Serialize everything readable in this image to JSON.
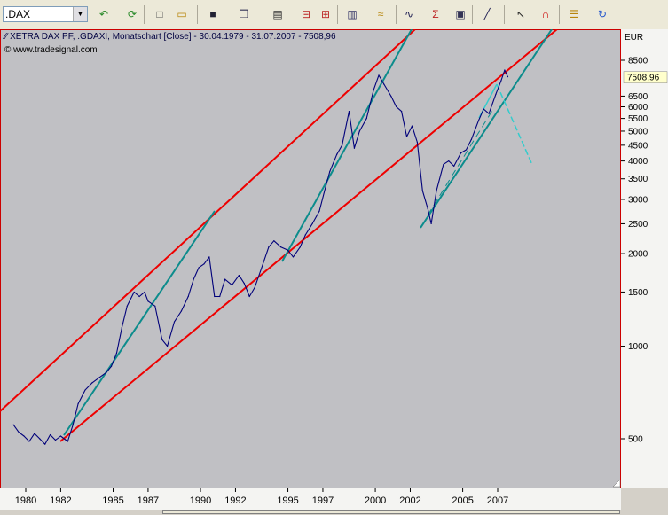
{
  "toolbar": {
    "symbol": ".DAX",
    "buttons": [
      {
        "name": "undo-arrow-icon",
        "glyph": "↶",
        "color": "#2a8a2a"
      },
      {
        "name": "refresh-icon",
        "glyph": "⟳",
        "color": "#2a8a2a"
      },
      {
        "name": "new-document-icon",
        "glyph": "□",
        "color": "#555"
      },
      {
        "name": "open-folder-icon",
        "glyph": "▭",
        "color": "#b8860b"
      },
      {
        "name": "save-disk-icon",
        "glyph": "■",
        "color": "#223"
      },
      {
        "name": "copy-icon",
        "glyph": "❐",
        "color": "#335"
      },
      {
        "name": "print-icon",
        "glyph": "▤",
        "color": "#333"
      },
      {
        "name": "chart-window-icon",
        "glyph": "⊟",
        "color": "#b22"
      },
      {
        "name": "chart-window-2-icon",
        "glyph": "⊞",
        "color": "#b22"
      },
      {
        "name": "layout-icon",
        "glyph": "▥",
        "color": "#336"
      },
      {
        "name": "indicator-icon",
        "glyph": "≈",
        "color": "#b8860b"
      },
      {
        "name": "studies-icon",
        "glyph": "∿",
        "color": "#225"
      },
      {
        "name": "sigma-icon",
        "glyph": "Σ",
        "color": "#b22"
      },
      {
        "name": "properties-icon",
        "glyph": "▣",
        "color": "#335"
      },
      {
        "name": "draw-line-icon",
        "glyph": "╱",
        "color": "#225"
      },
      {
        "name": "cursor-icon",
        "glyph": "↖",
        "color": "#222"
      },
      {
        "name": "magnet-icon",
        "glyph": "∩",
        "color": "#c00"
      },
      {
        "name": "settings-icon",
        "glyph": "☰",
        "color": "#b8860b"
      },
      {
        "name": "rotate-icon",
        "glyph": "↻",
        "color": "#2255cc"
      }
    ]
  },
  "chart_title": "XETRA DAX PF, .GDAXI, Monatschart [Close] - 30.04.1979 - 31.07.2007 - 7508,96",
  "copyright": "© www.tradesignal.com",
  "colors": {
    "plot_bg": "#c0c0c4",
    "price_line": "#00007a",
    "channel": "#ee0000",
    "trend": "#0c8c8c",
    "projection": "#33cccc",
    "last_label_bg": "#ffffcc"
  },
  "chart_data": {
    "type": "line",
    "title": "XETRA DAX PF, .GDAXI, Monatschart [Close] - 30.04.1979 - 31.07.2007 - 7508,96",
    "scale": "log",
    "y_unit": "EUR",
    "last_value_label": "7508,96",
    "y_ticks": [
      {
        "value": 500,
        "label": "500"
      },
      {
        "value": 1000,
        "label": "1000"
      },
      {
        "value": 1500,
        "label": "1500"
      },
      {
        "value": 2000,
        "label": "2000"
      },
      {
        "value": 2500,
        "label": "2500"
      },
      {
        "value": 3000,
        "label": "3000"
      },
      {
        "value": 3500,
        "label": "3500"
      },
      {
        "value": 4000,
        "label": "4000"
      },
      {
        "value": 4500,
        "label": "4500"
      },
      {
        "value": 5000,
        "label": "5000"
      },
      {
        "value": 5500,
        "label": "5500"
      },
      {
        "value": 6000,
        "label": "6000"
      },
      {
        "value": 6500,
        "label": "6500"
      },
      {
        "value": 8500,
        "label": "8500"
      }
    ],
    "x_ticks": [
      "1980",
      "1982",
      "1985",
      "1987",
      "1990",
      "1992",
      "1995",
      "1997",
      "2000",
      "2002",
      "2005",
      "2007"
    ],
    "x_tick_values": [
      1980,
      1982,
      1985,
      1987,
      1990,
      1992,
      1995,
      1997,
      2000,
      2002,
      2005,
      2007
    ],
    "series": [
      {
        "points": [
          [
            1979.3,
            555
          ],
          [
            1979.6,
            525
          ],
          [
            1979.9,
            510
          ],
          [
            1980.2,
            490
          ],
          [
            1980.5,
            520
          ],
          [
            1980.8,
            500
          ],
          [
            1981.1,
            480
          ],
          [
            1981.4,
            515
          ],
          [
            1981.7,
            495
          ],
          [
            1982.0,
            510
          ],
          [
            1982.4,
            490
          ],
          [
            1982.7,
            555
          ],
          [
            1983.0,
            650
          ],
          [
            1983.4,
            720
          ],
          [
            1983.8,
            760
          ],
          [
            1984.2,
            790
          ],
          [
            1984.6,
            820
          ],
          [
            1984.9,
            860
          ],
          [
            1985.2,
            950
          ],
          [
            1985.5,
            1150
          ],
          [
            1985.8,
            1350
          ],
          [
            1986.2,
            1500
          ],
          [
            1986.5,
            1450
          ],
          [
            1986.8,
            1500
          ],
          [
            1987.0,
            1400
          ],
          [
            1987.4,
            1350
          ],
          [
            1987.8,
            1050
          ],
          [
            1988.1,
            1000
          ],
          [
            1988.5,
            1200
          ],
          [
            1988.9,
            1300
          ],
          [
            1989.3,
            1450
          ],
          [
            1989.6,
            1650
          ],
          [
            1989.9,
            1800
          ],
          [
            1990.2,
            1850
          ],
          [
            1990.5,
            1950
          ],
          [
            1990.8,
            1450
          ],
          [
            1991.1,
            1450
          ],
          [
            1991.4,
            1650
          ],
          [
            1991.8,
            1580
          ],
          [
            1992.2,
            1700
          ],
          [
            1992.5,
            1600
          ],
          [
            1992.8,
            1450
          ],
          [
            1993.1,
            1550
          ],
          [
            1993.5,
            1800
          ],
          [
            1993.9,
            2100
          ],
          [
            1994.2,
            2200
          ],
          [
            1994.6,
            2100
          ],
          [
            1995.0,
            2050
          ],
          [
            1995.3,
            1950
          ],
          [
            1995.7,
            2100
          ],
          [
            1996.0,
            2300
          ],
          [
            1996.4,
            2500
          ],
          [
            1996.8,
            2750
          ],
          [
            1997.1,
            3200
          ],
          [
            1997.4,
            3700
          ],
          [
            1997.8,
            4200
          ],
          [
            1998.1,
            4500
          ],
          [
            1998.5,
            5800
          ],
          [
            1998.8,
            4400
          ],
          [
            1999.1,
            5000
          ],
          [
            1999.5,
            5500
          ],
          [
            1999.9,
            6800
          ],
          [
            2000.2,
            7600
          ],
          [
            2000.5,
            7100
          ],
          [
            2000.9,
            6500
          ],
          [
            2001.2,
            6000
          ],
          [
            2001.5,
            5800
          ],
          [
            2001.8,
            4800
          ],
          [
            2002.1,
            5200
          ],
          [
            2002.4,
            4600
          ],
          [
            2002.7,
            3200
          ],
          [
            2003.0,
            2800
          ],
          [
            2003.2,
            2500
          ],
          [
            2003.5,
            3200
          ],
          [
            2003.9,
            3900
          ],
          [
            2004.2,
            4000
          ],
          [
            2004.5,
            3850
          ],
          [
            2004.9,
            4250
          ],
          [
            2005.2,
            4350
          ],
          [
            2005.5,
            4700
          ],
          [
            2005.9,
            5400
          ],
          [
            2006.2,
            5900
          ],
          [
            2006.5,
            5700
          ],
          [
            2006.9,
            6600
          ],
          [
            2007.2,
            7300
          ],
          [
            2007.4,
            7900
          ],
          [
            2007.58,
            7508.96
          ]
        ]
      }
    ]
  }
}
